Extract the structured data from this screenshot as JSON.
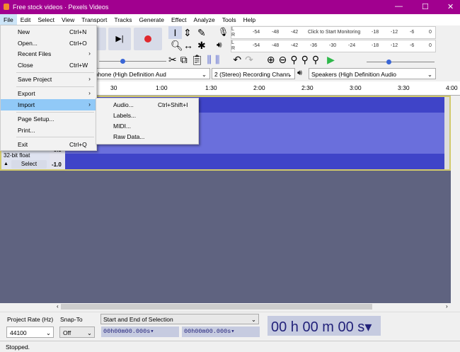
{
  "window": {
    "title": "Free stock videos · Pexels Videos",
    "min": "—",
    "max": "☐",
    "close": "✕"
  },
  "menubar": [
    "File",
    "Edit",
    "Select",
    "View",
    "Transport",
    "Tracks",
    "Generate",
    "Effect",
    "Analyze",
    "Tools",
    "Help"
  ],
  "meters": {
    "record_ticks": [
      "-54",
      "-48",
      "-42",
      "-18",
      "-12",
      "-6",
      "0"
    ],
    "record_prompt": "Click to Start Monitoring",
    "play_ticks": [
      "-54",
      "-48",
      "-42",
      "-36",
      "-30",
      "-24",
      "-18",
      "-12",
      "-6",
      "0"
    ],
    "L": "L",
    "R": "R"
  },
  "devices": {
    "input": "ophone (High Definition Aud",
    "channels": "2 (Stereo) Recording Chann",
    "output": "Speakers (High Definition Audio"
  },
  "ruler": [
    "30",
    "1:00",
    "1:30",
    "2:00",
    "2:30",
    "3:00",
    "3:30",
    "4:00"
  ],
  "track": {
    "format": "32-bit float",
    "select": "Select",
    "scale_mid": "-0.5",
    "scale_bottom": "-1.0"
  },
  "file_menu": [
    {
      "label": "New",
      "shortcut": "Ctrl+N"
    },
    {
      "label": "Open...",
      "shortcut": "Ctrl+O"
    },
    {
      "label": "Recent Files",
      "arrow": "›"
    },
    {
      "label": "Close",
      "shortcut": "Ctrl+W"
    },
    {
      "label": "Save Project",
      "arrow": "›"
    },
    {
      "label": "Export",
      "arrow": "›"
    },
    {
      "label": "Import",
      "arrow": "›"
    },
    {
      "label": "Page Setup..."
    },
    {
      "label": "Print..."
    },
    {
      "label": "Exit",
      "shortcut": "Ctrl+Q"
    }
  ],
  "import_menu": [
    {
      "label": "Audio...",
      "shortcut": "Ctrl+Shift+I"
    },
    {
      "label": "Labels..."
    },
    {
      "label": "MIDI..."
    },
    {
      "label": "Raw Data..."
    }
  ],
  "bottom": {
    "rate_label": "Project Rate (Hz)",
    "snap_label": "Snap-To",
    "rate": "44100",
    "snap": "Off",
    "selection_mode": "Start and End of Selection",
    "sel_start": "00h00m00.000s",
    "sel_end": "00h00m00.000s",
    "time": "00 h 00 m 00 s"
  },
  "status": "Stopped."
}
